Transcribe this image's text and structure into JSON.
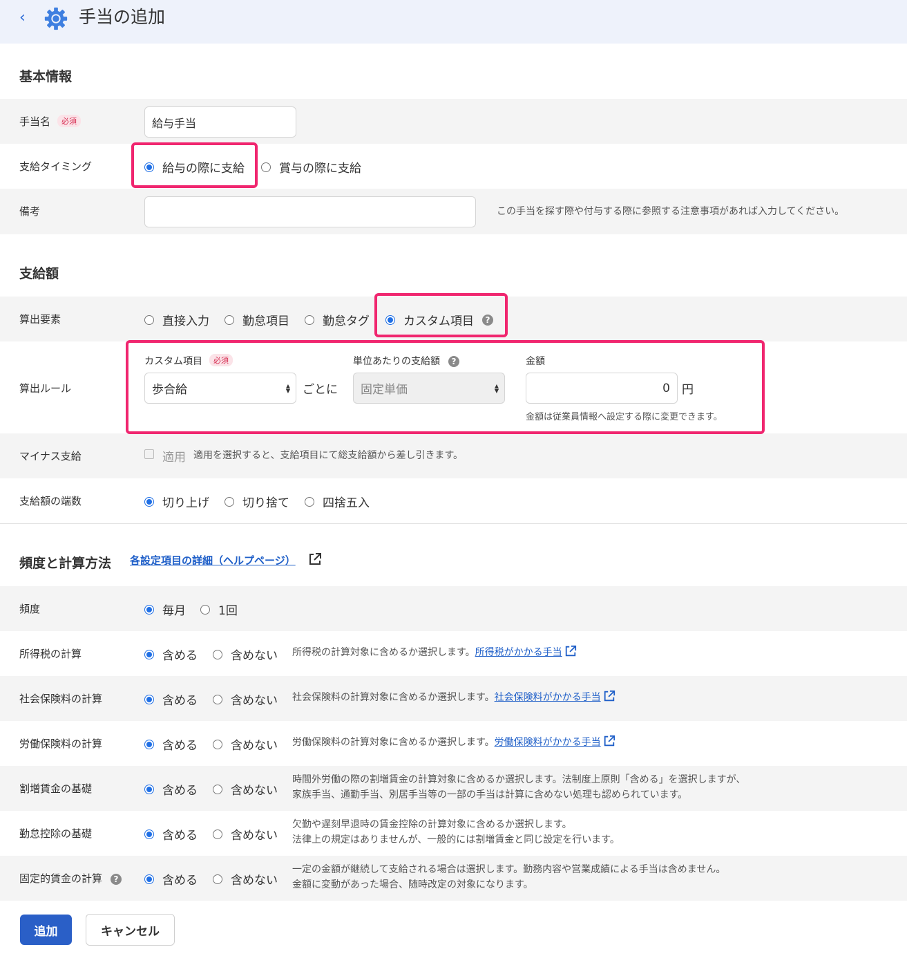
{
  "header": {
    "title": "手当の追加"
  },
  "basic": {
    "section_title": "基本情報",
    "required": "必須",
    "name_label": "手当名",
    "name_value": "給与手当",
    "timing_label": "支給タイミング",
    "timing_options": [
      "給与の際に支給",
      "賞与の際に支給"
    ],
    "notes_label": "備考",
    "notes_hint": "この手当を探す際や付与する際に参照する注意事項があれば入力してください。"
  },
  "amount": {
    "section_title": "支給額",
    "element_label": "算出要素",
    "element_options": [
      "直接入力",
      "勤怠項目",
      "勤怠タグ",
      "カスタム項目"
    ],
    "rule_label": "算出ルール",
    "custom_item_label": "カスタム項目",
    "custom_item_value": "歩合給",
    "per_text": "ごとに",
    "unit_amount_label": "単位あたりの支給額",
    "unit_amount_value": "固定単価",
    "kingaku_label": "金額",
    "kingaku_value": "0",
    "yen": "円",
    "kingaku_note": "金額は従業員情報へ設定する際に変更できます。",
    "minus_label": "マイナス支給",
    "minus_checkbox_label": "適用",
    "minus_note": "適用を選択すると、支給項目にて総支給額から差し引きます。",
    "rounding_label": "支給額の端数",
    "rounding_options": [
      "切り上げ",
      "切り捨て",
      "四捨五入"
    ]
  },
  "calc": {
    "section_title": "頻度と計算方法",
    "help_link": "各設定項目の詳細（ヘルプページ）",
    "frequency_label": "頻度",
    "frequency_options": [
      "毎月",
      "1回"
    ],
    "include": "含める",
    "exclude": "含めない",
    "income_tax_label": "所得税の計算",
    "income_tax_note": "所得税の計算対象に含めるか選択します。",
    "income_tax_link": "所得税がかかる手当",
    "social_label": "社会保険料の計算",
    "social_note": "社会保険料の計算対象に含めるか選択します。",
    "social_link": "社会保険料がかかる手当",
    "labor_label": "労働保険料の計算",
    "labor_note": "労働保険料の計算対象に含めるか選択します。",
    "labor_link": "労働保険料がかかる手当",
    "overtime_label": "割増賃金の基礎",
    "overtime_note1": "時間外労働の際の割増賃金の計算対象に含めるか選択します。法制度上原則「含める」を選択しますが、",
    "overtime_note2": "家族手当、通勤手当、別居手当等の一部の手当は計算に含めない処理も認められています。",
    "absence_label": "勤怠控除の基礎",
    "absence_note1": "欠勤や遅刻早退時の賃金控除の計算対象に含めるか選択します。",
    "absence_note2": "法律上の規定はありませんが、一般的には割増賃金と同じ設定を行います。",
    "fixed_label": "固定的賃金の計算",
    "fixed_note1": "一定の金額が継続して支給される場合は選択します。勤務内容や営業成績による手当は含めません。",
    "fixed_note2": "金額に変動があった場合、随時改定の対象になります。"
  },
  "buttons": {
    "add": "追加",
    "cancel": "キャンセル"
  },
  "colors": {
    "accent": "#1f6fe5",
    "highlight": "#f0266f",
    "primary_button": "#2a5fc7",
    "required": "#d62e52"
  }
}
